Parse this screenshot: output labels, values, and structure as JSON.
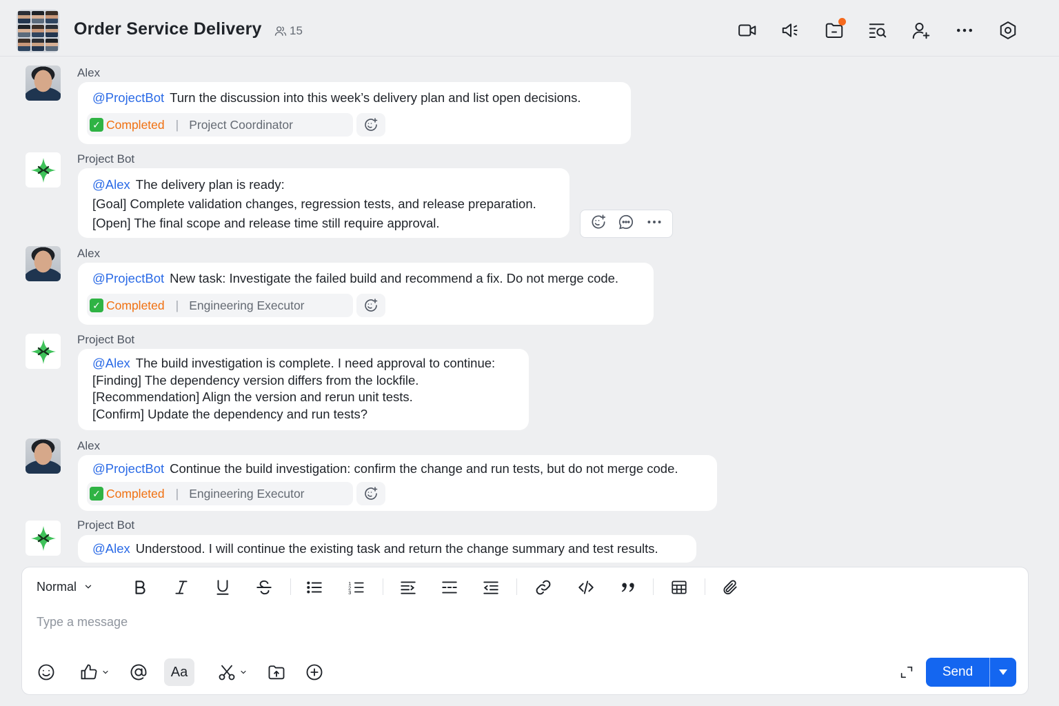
{
  "header": {
    "title": "Order Service Delivery",
    "member_count": "15",
    "icons": [
      "video-call-icon",
      "announcement-icon",
      "folder-icon",
      "search-history-icon",
      "add-member-icon",
      "more-icon",
      "settings-icon"
    ],
    "notification_color": "#f5691d"
  },
  "messages": [
    {
      "sender": "Alex",
      "mention": "@ProjectBot",
      "lines": [
        "Turn the discussion into this week’s delivery plan and list open decisions."
      ],
      "status": "Completed",
      "role": "Project Coordinator"
    },
    {
      "sender": "Project Bot",
      "mention": "@Alex",
      "lines": [
        "The delivery plan is ready:",
        "[Goal] Complete validation changes, regression tests, and release preparation.",
        "[Open] The final scope and release time still require approval."
      ]
    },
    {
      "sender": "Alex",
      "mention": "@ProjectBot",
      "lines": [
        "New task: Investigate the failed build and recommend a fix. Do not merge code."
      ],
      "status": "Completed",
      "role": "Engineering Executor"
    },
    {
      "sender": "Project Bot",
      "mention": "@Alex",
      "lines": [
        "The build investigation is complete. I need approval to continue:",
        "[Finding] The dependency version differs from the lockfile.",
        "[Recommendation] Align the version and rerun unit tests.",
        "[Confirm] Update the dependency and run tests?"
      ]
    },
    {
      "sender": "Alex",
      "mention": "@ProjectBot",
      "lines": [
        "Continue the build investigation: confirm the change and run tests, but do not merge code."
      ],
      "status": "Completed",
      "role": "Engineering Executor"
    },
    {
      "sender": "Project Bot",
      "mention": "@Alex",
      "lines": [
        "Understood. I will continue the existing task and return the change summary and test results."
      ]
    }
  ],
  "composer": {
    "format": "Normal",
    "placeholder": "Type a message",
    "send_label": "Send",
    "toolbar": [
      "bold-icon",
      "italic-icon",
      "underline-icon",
      "strikethrough-icon",
      "bullet-list-icon",
      "numbered-list-icon",
      "indent-icon",
      "divider-icon",
      "outdent-icon",
      "link-icon",
      "code-icon",
      "quote-icon",
      "table-icon",
      "attachment-icon"
    ],
    "bottom": [
      "emoji-icon",
      "thumbs-up-icon",
      "mention-icon",
      "text-format-icon",
      "screenshot-icon",
      "upload-icon",
      "add-icon",
      "expand-icon"
    ],
    "font_button": "Aa"
  },
  "colors": {
    "accent": "#1466f0",
    "mention": "#2a6ae6",
    "completed": "#f07010",
    "bot_green": "#3fc25a"
  }
}
